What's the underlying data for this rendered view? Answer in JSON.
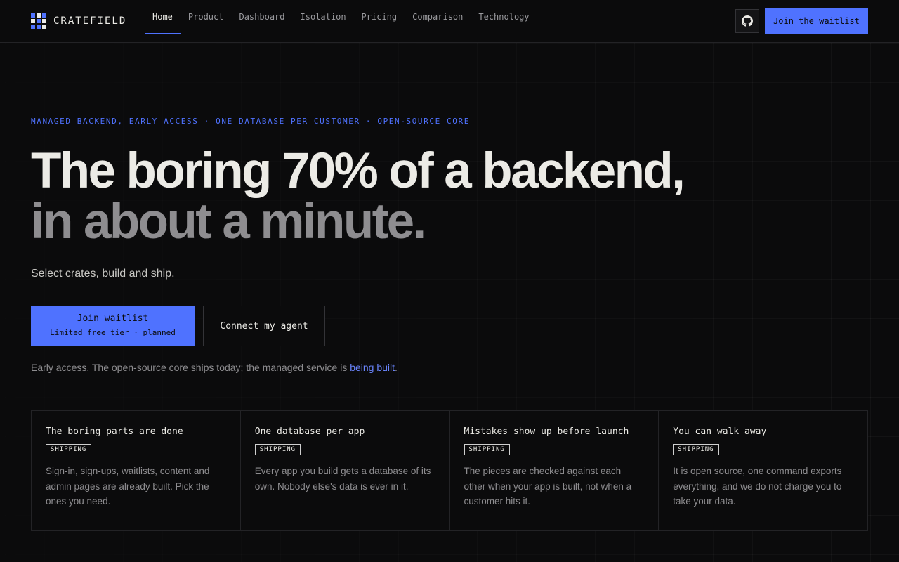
{
  "colors": {
    "accent": "#4f72ff",
    "background": "#0b0b0c",
    "text": "#ecebe6",
    "muted": "#8e8d90",
    "border": "#232326"
  },
  "header": {
    "logo_text": "CRATEFIELD",
    "logo_icon": "grid-logo-icon",
    "nav": [
      {
        "label": "Home",
        "active": true
      },
      {
        "label": "Product",
        "active": false
      },
      {
        "label": "Dashboard",
        "active": false
      },
      {
        "label": "Isolation",
        "active": false
      },
      {
        "label": "Pricing",
        "active": false
      },
      {
        "label": "Comparison",
        "active": false
      },
      {
        "label": "Technology",
        "active": false
      }
    ],
    "github_icon": "github-icon",
    "cta_label": "Join the waitlist"
  },
  "hero": {
    "eyebrow": "MANAGED BACKEND, EARLY ACCESS · ONE DATABASE PER CUSTOMER · OPEN-SOURCE CORE",
    "headline_line1": "The boring 70% of a backend,",
    "headline_line2": "in about a minute.",
    "subtitle": "Select crates, build and ship.",
    "primary_cta": {
      "label": "Join waitlist",
      "sublabel": "Limited free tier · planned"
    },
    "secondary_cta": {
      "label": "Connect my agent"
    },
    "note_text": "Early access. The open-source core ships today; the managed service is ",
    "note_link": "being built",
    "note_end": "."
  },
  "features": [
    {
      "title": "The boring parts are done",
      "badge": "SHIPPING",
      "description": "Sign-in, sign-ups, waitlists, content and admin pages are already built. Pick the ones you need."
    },
    {
      "title": "One database per app",
      "badge": "SHIPPING",
      "description": "Every app you build gets a database of its own. Nobody else's data is ever in it."
    },
    {
      "title": "Mistakes show up before launch",
      "badge": "SHIPPING",
      "description": "The pieces are checked against each other when your app is built, not when a customer hits it."
    },
    {
      "title": "You can walk away",
      "badge": "SHIPPING",
      "description": "It is open source, one command exports everything, and we do not charge you to take your data."
    }
  ]
}
